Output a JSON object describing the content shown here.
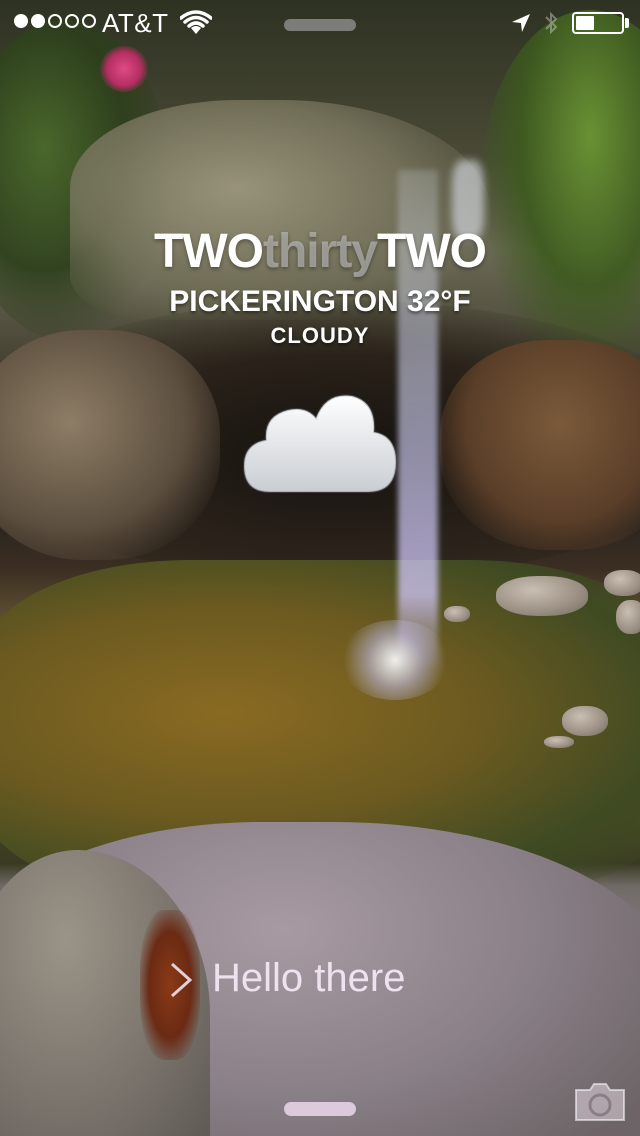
{
  "status_bar": {
    "signal_bars_filled": 2,
    "signal_bars_total": 5,
    "carrier": "AT&T",
    "battery_level": 0.4,
    "icons": [
      "wifi-icon",
      "location-arrow-icon",
      "bluetooth-icon",
      "battery-icon"
    ]
  },
  "widget": {
    "time_hour": "TWO",
    "time_minutes": "thirty",
    "time_minutes_end": "TWO",
    "location_temp": "PICKERINGTON 32°F",
    "condition": "CLOUDY",
    "weather_icon": "cloud-icon"
  },
  "lock": {
    "slide_label": "Hello there",
    "camera_icon": "camera-icon"
  },
  "colors": {
    "text_primary": "#ffffff",
    "text_dim": "#bebebe",
    "slide_text": "#f5ebfa"
  }
}
